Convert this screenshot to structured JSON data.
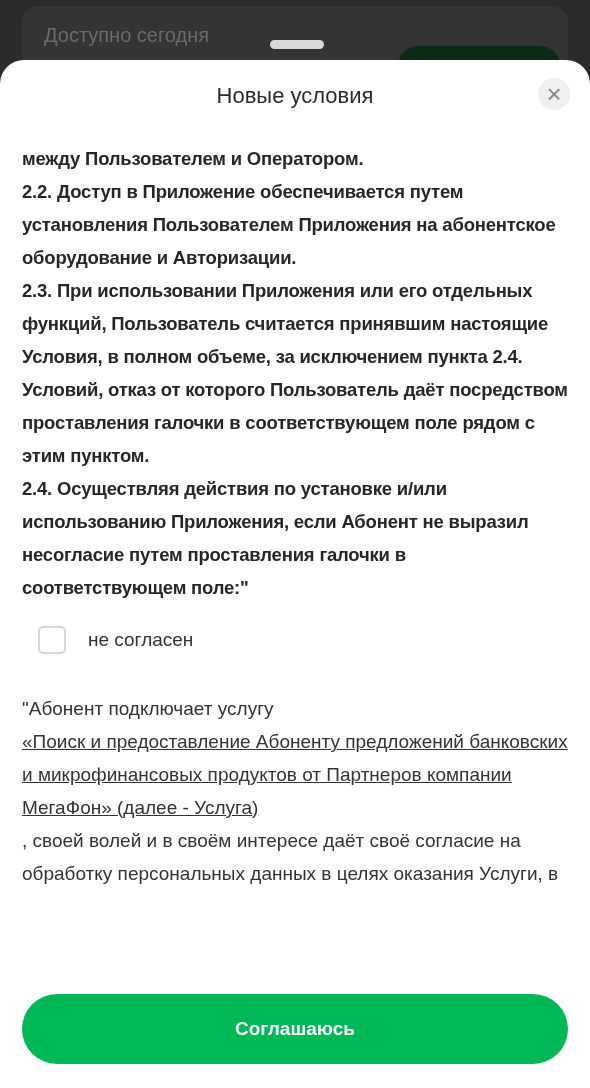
{
  "background": {
    "card_label": "Доступно сегодня"
  },
  "sheet": {
    "title": "Новые условия",
    "close": "×",
    "terms": [
      "между Пользователем и Оператором.",
      "2.2. Доступ в Приложение обеспечивается путем установления Пользователем Приложения на абонентское оборудование и Авторизации.",
      "2.3. При использовании Приложения или его отдельных функций, Пользователь считается принявшим настоящие Условия, в полном объеме, за исключением пункта 2.4. Условий, отказ от которого Пользователь даёт посредством проставления галочки в соответствующем поле рядом с этим пунктом.",
      "2.4. Осуществляя действия по установке и/или использованию Приложения, если Абонент не выразил несогласие путем проставления галочки в соответствующем поле:\""
    ],
    "checkbox": {
      "label": "не согласен",
      "checked": false
    },
    "consent": {
      "prefix": "\"Абонент подключает услугу ",
      "link": "«Поиск и предоставление Абоненту предложений банковских и микрофинансовых продуктов от Партнеров компании МегаФон» (далее - Услуга)",
      "suffix": ", своей волей и в своём интересе даёт своё согласие на обработку персональных данных в целях оказания Услуги, в"
    },
    "button": "Соглашаюсь"
  }
}
